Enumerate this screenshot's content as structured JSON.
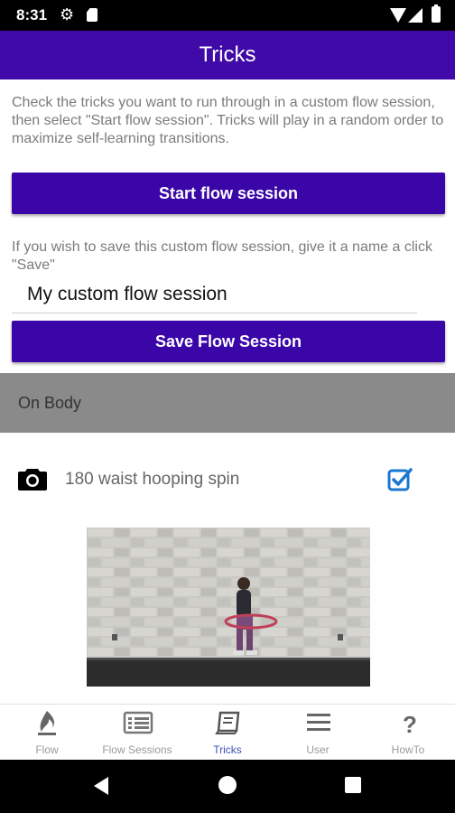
{
  "status_bar": {
    "time": "8:31"
  },
  "app_bar": {
    "title": "Tricks"
  },
  "instructions": "Check the tricks you want to run through in a custom flow session, then select \"Start flow session\". Tricks will play in a random order to maximize self-learning transitions.",
  "start_button_label": "Start flow session",
  "save_hint": "If you wish to save this custom flow session, give it a name a click \"Save\"",
  "session_name_input": {
    "value": "My custom flow session"
  },
  "save_button_label": "Save Flow Session",
  "section_header": "On Body",
  "trick": {
    "label": "180 waist hooping spin",
    "checked": true,
    "icon": "camera-icon"
  },
  "bottom_nav": [
    {
      "label": "Flow",
      "icon": "flame-icon",
      "active": false
    },
    {
      "label": "Flow Sessions",
      "icon": "list-icon",
      "active": false
    },
    {
      "label": "Tricks",
      "icon": "book-icon",
      "active": true
    },
    {
      "label": "User",
      "icon": "menu-icon",
      "active": false
    },
    {
      "label": "HowTo",
      "icon": "question-icon",
      "active": false
    }
  ],
  "colors": {
    "primary": "#3f0aa8",
    "accent": "#1976d2",
    "active_nav": "#3f51b5",
    "section_bg": "#8a8a8a"
  }
}
